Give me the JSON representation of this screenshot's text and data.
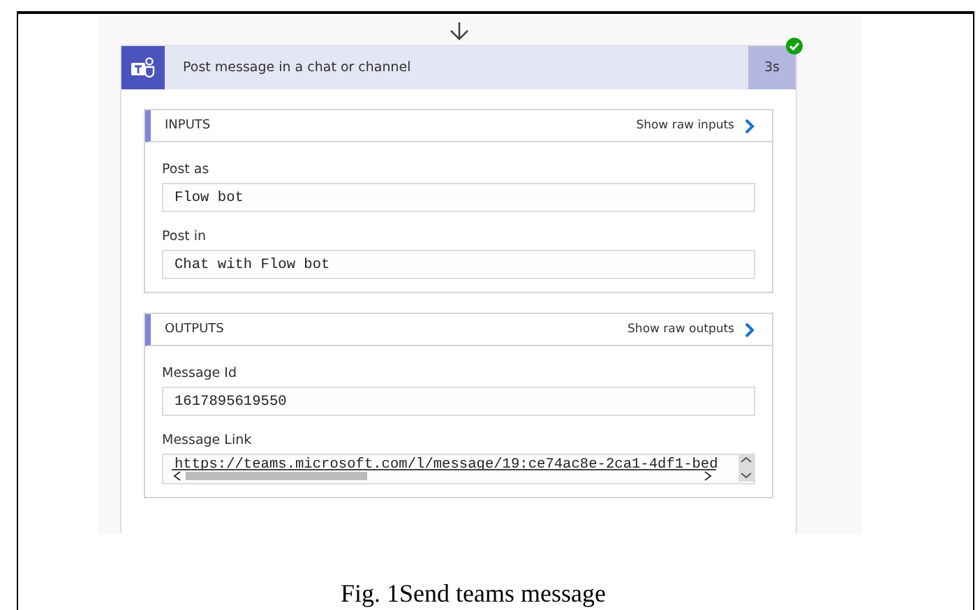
{
  "action": {
    "title": "Post message in a chat or channel",
    "duration": "3s",
    "succeeded": true
  },
  "sections": [
    {
      "heading": "INPUTS",
      "raw_link": "Show raw inputs",
      "fields": [
        {
          "label": "Post as",
          "value": "Flow bot",
          "scrollable": false
        },
        {
          "label": "Post in",
          "value": "Chat with Flow bot",
          "scrollable": false
        }
      ]
    },
    {
      "heading": "OUTPUTS",
      "raw_link": "Show raw outputs",
      "fields": [
        {
          "label": "Message Id",
          "value": "1617895619550",
          "scrollable": false
        },
        {
          "label": "Message Link",
          "value": "https://teams.microsoft.com/l/message/19:ce74ac8e-2ca1-4df1-bed",
          "scrollable": true
        }
      ]
    }
  ],
  "caption": "Fig. 1Send teams message"
}
